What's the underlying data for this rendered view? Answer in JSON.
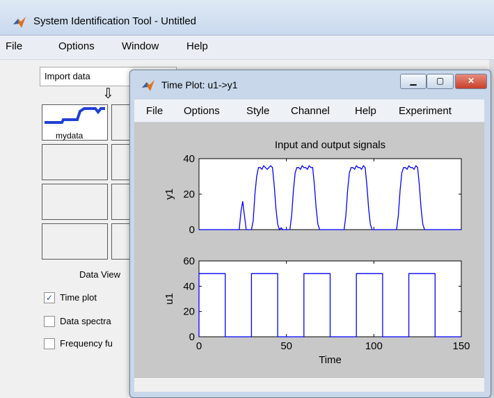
{
  "main_window": {
    "title": "System Identification Tool - Untitled",
    "menu": [
      "File",
      "Options",
      "Window",
      "Help"
    ],
    "import_select": {
      "value": "Import data"
    },
    "data_board": {
      "tiles": [
        {
          "label": "mydata"
        }
      ],
      "views_label": "Data View",
      "checkboxes": [
        {
          "label": "Time plot",
          "checked": true
        },
        {
          "label": "Data spectra",
          "checked": false
        },
        {
          "label": "Frequency fu",
          "checked": false
        }
      ]
    }
  },
  "plot_window": {
    "title": "Time Plot: u1->y1",
    "menu": [
      "File",
      "Options",
      "Style",
      "Channel",
      "Help",
      "Experiment"
    ]
  },
  "chart_data": {
    "type": "line",
    "title": "Input and output signals",
    "xlabel": "Time",
    "xlim": [
      0,
      150
    ],
    "xticks": [
      0,
      50,
      100,
      150
    ],
    "line_color": "#0000ff",
    "subplots": [
      {
        "ylabel": "y1",
        "ylim": [
          0,
          40
        ],
        "yticks": [
          0,
          20,
          40
        ],
        "series": [
          {
            "x": [
              0,
              23,
              24,
              25,
              26,
              27,
              28,
              29,
              30,
              31,
              32,
              33,
              34,
              35,
              36,
              37,
              38,
              39,
              40,
              41,
              42,
              43,
              44,
              45,
              46,
              47,
              48,
              52,
              53,
              54,
              55,
              56,
              57,
              58,
              59,
              60,
              61,
              62,
              63,
              64,
              65,
              66,
              67,
              68,
              69,
              70,
              75,
              78,
              83,
              84,
              85,
              86,
              87,
              88,
              89,
              90,
              91,
              92,
              93,
              94,
              95,
              96,
              97,
              98,
              99,
              100,
              105,
              108,
              113,
              114,
              115,
              116,
              117,
              118,
              119,
              120,
              121,
              122,
              123,
              124,
              125,
              126,
              127,
              128,
              129,
              130,
              136,
              138,
              150
            ],
            "y": [
              0,
              0,
              10,
              16,
              8,
              0,
              0,
              0,
              0,
              5,
              20,
              30,
              35,
              35,
              34,
              36,
              35,
              34,
              35,
              36,
              35,
              25,
              12,
              3,
              0,
              1,
              0,
              0,
              8,
              22,
              32,
              35,
              35,
              34,
              36,
              35,
              35,
              34,
              36,
              35,
              35,
              25,
              12,
              3,
              0,
              0,
              0,
              0,
              0,
              8,
              22,
              32,
              35,
              35,
              34,
              36,
              35,
              35,
              34,
              36,
              35,
              25,
              12,
              3,
              0,
              0,
              0,
              0,
              0,
              8,
              22,
              32,
              35,
              35,
              34,
              36,
              35,
              35,
              34,
              36,
              35,
              25,
              12,
              3,
              0,
              0,
              0,
              0,
              0
            ]
          }
        ]
      },
      {
        "ylabel": "u1",
        "ylim": [
          0,
          60
        ],
        "yticks": [
          0,
          20,
          40,
          60
        ],
        "series": [
          {
            "x": [
              0,
              0,
              15,
              15,
              30,
              30,
              45,
              45,
              60,
              60,
              75,
              75,
              90,
              90,
              105,
              105,
              120,
              120,
              135,
              135,
              150
            ],
            "y": [
              0,
              50,
              50,
              0,
              0,
              50,
              50,
              0,
              0,
              50,
              50,
              0,
              0,
              50,
              50,
              0,
              0,
              50,
              50,
              0,
              0
            ]
          }
        ]
      }
    ]
  }
}
